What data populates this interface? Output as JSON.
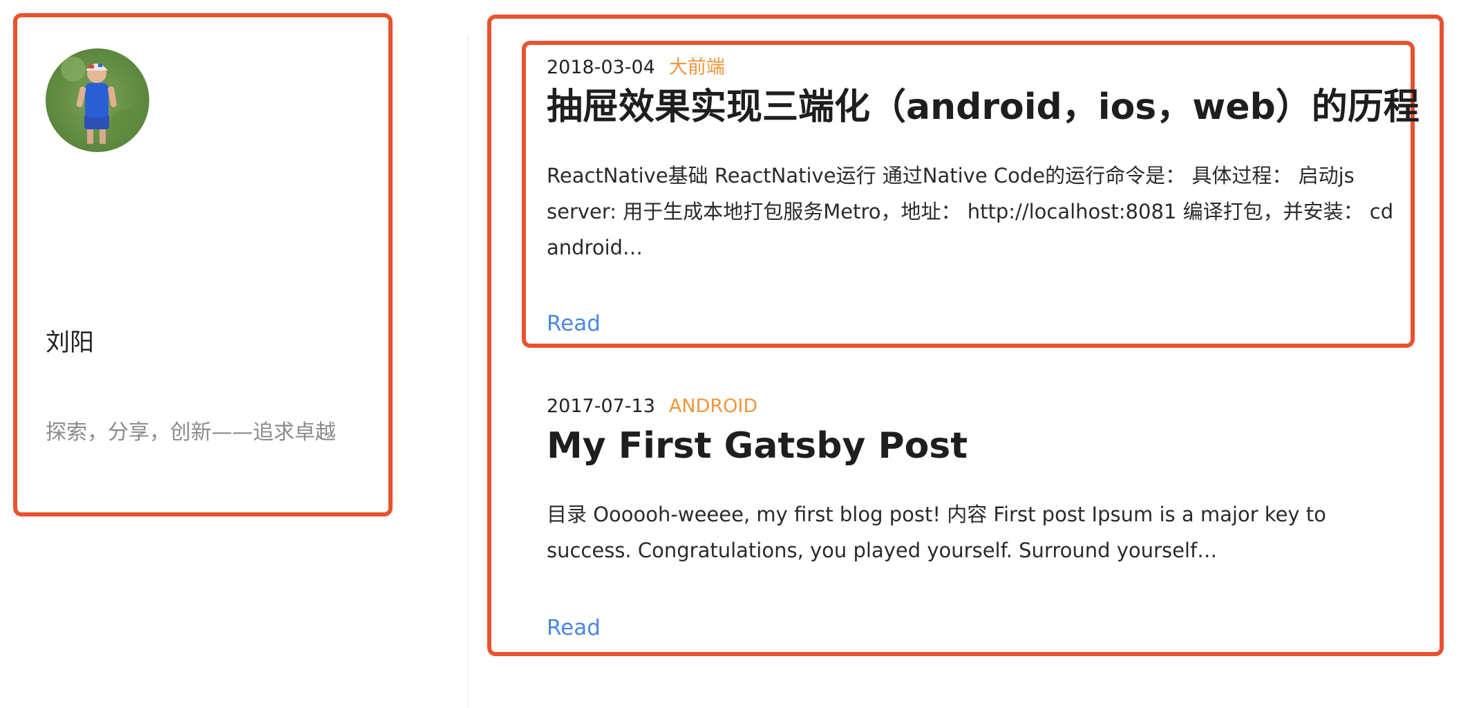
{
  "sidebar": {
    "author_name": "刘阳",
    "motto": "探索，分享，创新——追求卓越"
  },
  "posts": [
    {
      "date": "2018-03-04",
      "tag": "大前端",
      "title": "抽屉效果实现三端化（android，ios，web）的历程",
      "excerpt": "ReactNative基础 ReactNative运行 通过Native Code的运行命令是： 具体过程： 启动js server: 用于生成本地打包服务Metro，地址： http://localhost:8081 编译打包，并安装： cd android…",
      "read_label": "Read"
    },
    {
      "date": "2017-07-13",
      "tag": "ANDROID",
      "title": "My First Gatsby Post",
      "excerpt": "目录 Oooooh-weeee, my first blog post! 内容 First post Ipsum is a major key to success. Congratulations, you played yourself. Surround yourself…",
      "read_label": "Read"
    }
  ],
  "colors": {
    "highlight_border": "#e8532e",
    "tag": "#f0953a",
    "link": "#4a87e0",
    "motto": "#8a8a8a"
  },
  "icons": {
    "avatar": "avatar-photo"
  }
}
